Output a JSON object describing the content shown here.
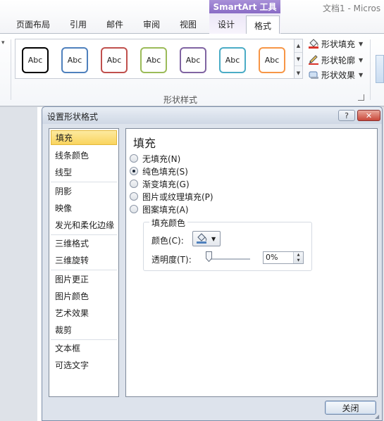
{
  "ribbon": {
    "contextual_group": "SmartArt 工具",
    "document_title": "文档1 - Micros",
    "tabs": [
      {
        "label": "页面布局"
      },
      {
        "label": "引用"
      },
      {
        "label": "邮件"
      },
      {
        "label": "审阅"
      },
      {
        "label": "视图"
      },
      {
        "label": "设计"
      },
      {
        "label": "格式"
      }
    ],
    "active_tab": "格式",
    "gallery": {
      "items": [
        {
          "label": "Abc",
          "color": "#000000"
        },
        {
          "label": "Abc",
          "color": "#4f81bd"
        },
        {
          "label": "Abc",
          "color": "#c0504d"
        },
        {
          "label": "Abc",
          "color": "#9bbb59"
        },
        {
          "label": "Abc",
          "color": "#8064a2"
        },
        {
          "label": "Abc",
          "color": "#4bacc6"
        },
        {
          "label": "Abc",
          "color": "#f79646"
        }
      ]
    },
    "commands": [
      {
        "label": "形状填充",
        "icon": "paint-bucket-icon"
      },
      {
        "label": "形状轮廓",
        "icon": "pencil-icon"
      },
      {
        "label": "形状效果",
        "icon": "shape-effects-icon"
      }
    ],
    "group_label": "形状样式"
  },
  "dialog": {
    "title": "设置形状格式",
    "help_label": "?",
    "close_glyph": "✕",
    "nav": [
      {
        "label": "填充",
        "active": true
      },
      {
        "label": "线条颜色"
      },
      {
        "label": "线型"
      },
      {
        "label": "阴影"
      },
      {
        "label": "映像"
      },
      {
        "label": "发光和柔化边缘"
      },
      {
        "label": "三维格式"
      },
      {
        "label": "三维旋转"
      },
      {
        "label": "图片更正"
      },
      {
        "label": "图片颜色"
      },
      {
        "label": "艺术效果"
      },
      {
        "label": "裁剪"
      },
      {
        "label": "文本框"
      },
      {
        "label": "可选文字"
      }
    ],
    "content_title": "填充",
    "fill_options": [
      {
        "label": "无填充(N)",
        "checked": false
      },
      {
        "label": "纯色填充(S)",
        "checked": true
      },
      {
        "label": "渐变填充(G)",
        "checked": false
      },
      {
        "label": "图片或纹理填充(P)",
        "checked": false
      },
      {
        "label": "图案填充(A)",
        "checked": false
      }
    ],
    "fill_color_group": "填充颜色",
    "color_label": "颜色(C):",
    "transparency_label": "透明度(T):",
    "transparency_value": "0%",
    "transparency_fraction": 0,
    "close_button": "关闭"
  }
}
